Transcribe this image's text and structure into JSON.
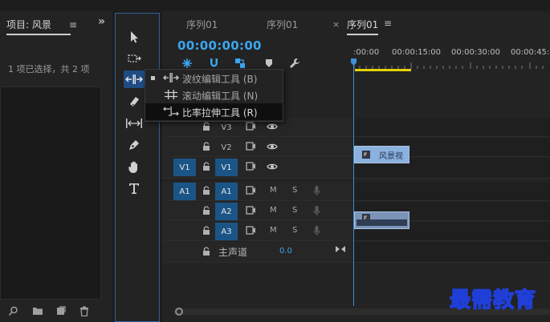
{
  "project": {
    "tab_label": "项目: 风景",
    "menu_icon": "≡",
    "expand_icon": "»",
    "status": "1 项已选择，共 2 项"
  },
  "tools": {
    "items": [
      "selection-tool",
      "track-select-tool",
      "ripple-edit-tool",
      "razor-tool",
      "slip-tool",
      "pen-tool",
      "hand-tool",
      "type-tool"
    ]
  },
  "timeline": {
    "tabs": [
      {
        "label": "序列01"
      },
      {
        "label": "序列01"
      },
      {
        "label": "序列01"
      }
    ],
    "close_icon": "×",
    "menu_icon": "≡",
    "timecode": "00:00:00:00",
    "ruler": [
      ":00:00",
      "00:00:15:00",
      "00:00:30:00",
      "00:00:45:0"
    ],
    "tracks": {
      "v3": "V3",
      "v2": "V2",
      "v1_source": "V1",
      "v1": "V1",
      "a1_source": "A1",
      "a1": "A1",
      "a2": "A2",
      "a3": "A3",
      "mute": "M",
      "solo": "S"
    },
    "master": {
      "label": "主声道",
      "value": "0.0"
    },
    "clip_v2_name": "风景视"
  },
  "flyout": {
    "items": [
      {
        "label": "波纹编辑工具 (B)"
      },
      {
        "label": "滚动编辑工具 (N)"
      },
      {
        "label": "比率拉伸工具 (R)"
      }
    ]
  },
  "watermark": "最需教育",
  "colors": {
    "accent": "#3aa6f0",
    "track_target": "#1b5587",
    "clip_video": "#8bb1df",
    "playhead": "#3f8fd6",
    "in_out": "#e3d20a"
  }
}
